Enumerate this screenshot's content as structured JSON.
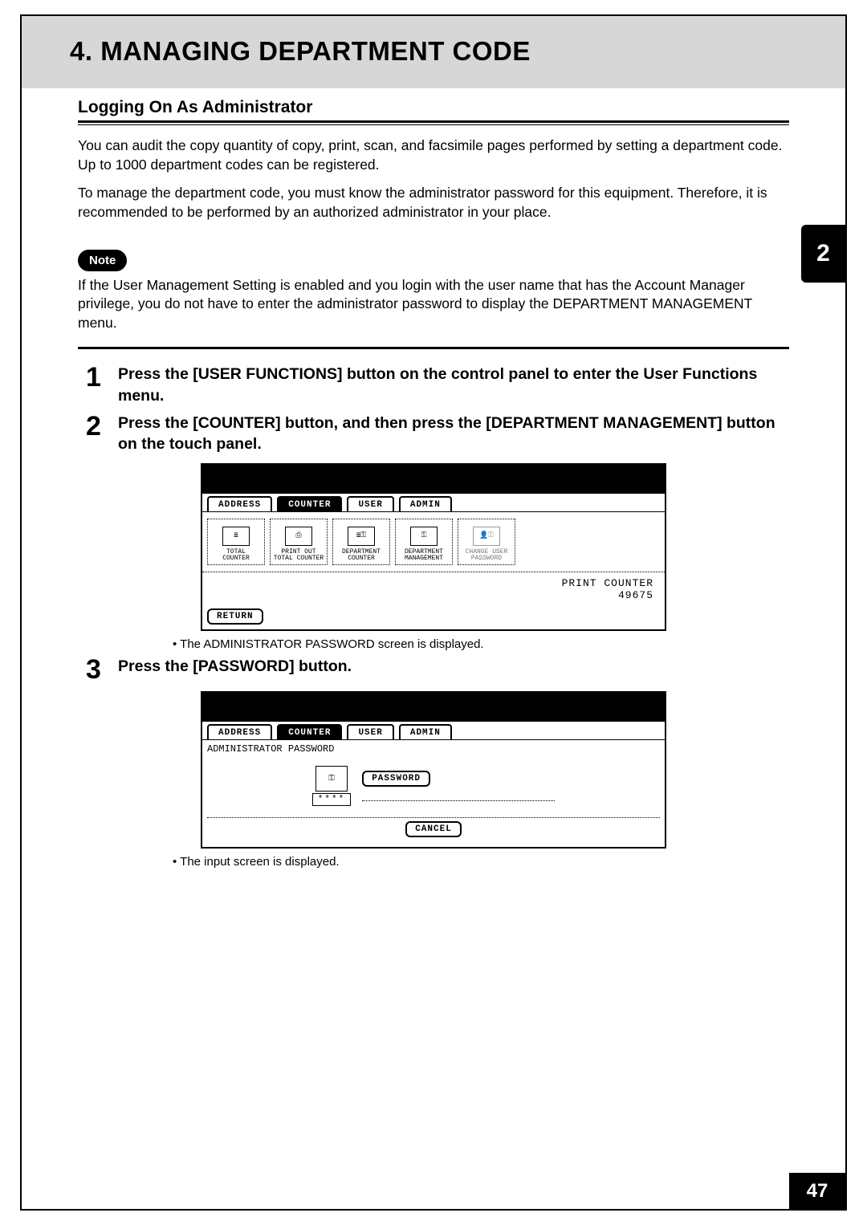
{
  "chapter_title": "4. MANAGING DEPARTMENT CODE",
  "section_title": "Logging On As Administrator",
  "intro_p1": "You can audit the copy quantity of copy, print, scan, and facsimile pages performed by setting a department code.  Up to 1000 department codes can be registered.",
  "intro_p2": "To manage the department code, you must know the administrator password for this equipment.  Therefore, it is recommended to be performed by an authorized administrator in your place.",
  "note_label": "Note",
  "note_text": "If the User Management Setting is enabled and you login with the user name that has the Account Manager privilege, you do not have to enter the administrator password to display the DEPARTMENT MANAGEMENT menu.",
  "steps": [
    {
      "num": "1",
      "text": "Press the [USER FUNCTIONS] button on the control panel to enter the User Functions menu."
    },
    {
      "num": "2",
      "text": "Press the [COUNTER] button, and then press the [DEPARTMENT MANAGEMENT] button on the touch panel."
    },
    {
      "num": "3",
      "text": "Press the [PASSWORD] button."
    }
  ],
  "bullets": {
    "after_step2": "The ADMINISTRATOR PASSWORD screen is displayed.",
    "after_step3": "The input screen is displayed."
  },
  "screen1": {
    "tabs": [
      "ADDRESS",
      "COUNTER",
      "USER",
      "ADMIN"
    ],
    "selected_tab": "COUNTER",
    "buttons": [
      "TOTAL\nCOUNTER",
      "PRINT OUT\nTOTAL COUNTER",
      "DEPARTMENT\nCOUNTER",
      "DEPARTMENT\nMANAGEMENT",
      "CHANGE USER\nPASSWORD"
    ],
    "side_label": "PRINT COUNTER",
    "side_value": "49675",
    "return_label": "RETURN"
  },
  "screen2": {
    "tabs": [
      "ADDRESS",
      "COUNTER",
      "USER",
      "ADMIN"
    ],
    "selected_tab": "COUNTER",
    "area_label": "ADMINISTRATOR PASSWORD",
    "pw_button": "PASSWORD",
    "pw_value": "****",
    "cancel_label": "CANCEL"
  },
  "chapter_tab": "2",
  "page_number": "47"
}
